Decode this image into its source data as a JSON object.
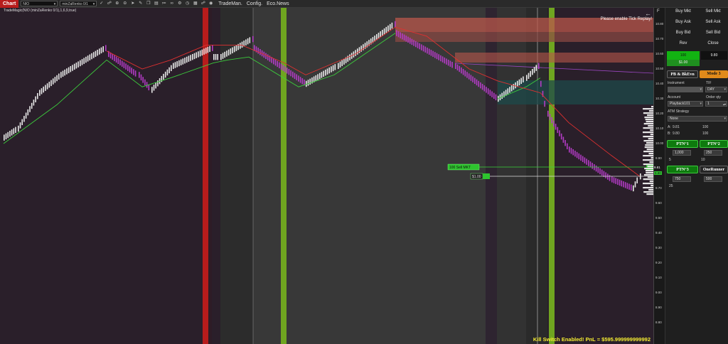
{
  "toolbar": {
    "tab": "Chart",
    "instrument": "NIO",
    "bars_type": "minZaRenko 0/1",
    "menus": [
      "TradeMan.",
      "Config.",
      "Eco.News"
    ],
    "icons": [
      "scale-icon",
      "link-icon",
      "zoom-in-icon",
      "zoom-out-icon",
      "pointer-icon",
      "drawing-icon",
      "copy-icon",
      "template-icon",
      "indicator-icon",
      "strategy-icon",
      "properties-icon",
      "time-icon",
      "grid-icon",
      "lock-icon",
      "camera-icon"
    ]
  },
  "chart": {
    "indicator_label": "TradeMagic(NIO (minZaRenko 0/1),1,6,9,true)",
    "tick_replay_msg": "Please enable Tick Replay!",
    "kill_switch_msg": "Kill Switch Enabled! PnL = $595.999999999992",
    "order_tags": {
      "upper_label": "100 Sell MKT",
      "upper_value": "9.80",
      "lower_label": "$1.00",
      "lower_value": "9.80"
    },
    "price_axis": {
      "header": "F",
      "ticks": [
        "10.80",
        "10.70",
        "10.60",
        "10.50",
        "10.40",
        "10.30",
        "10.20",
        "10.10",
        "10.00",
        "9.90",
        "9.80",
        "9.70",
        "9.60",
        "9.50",
        "9.40",
        "9.30",
        "9.20",
        "9.10",
        "9.00",
        "8.90",
        "8.80"
      ],
      "current_price": "9.80",
      "marker_price": "9.81"
    },
    "colors": {
      "background": "#2a1f2a",
      "green_band": "#6fa520",
      "red_band": "#b71c1c",
      "up_bar": "#e8e8e8",
      "down_bar": "#b23bc4",
      "stop_red": "#e03030",
      "stop_green": "#3ccc3c"
    }
  },
  "chart_trader": {
    "buy_mkt": "Buy Mkt",
    "sell_mkt": "Sell Mkt",
    "buy_ask": "Buy Ask",
    "sell_ask": "Sell Ask",
    "buy_bid": "Buy Bid",
    "sell_bid": "Sell Bid",
    "rev": "Rev",
    "close": "Close",
    "position_qty": "100",
    "position_price": "9.80",
    "pnl": "$1.00",
    "pb_btn": "PB & BkEvn",
    "mode_btn": "Mode 3",
    "instrument_label": "Instrument",
    "tif_label": "TIF",
    "tif_value": "DAY",
    "account_label": "Account",
    "account_value": "Playback101",
    "order_qty_label": "Order qty",
    "order_qty_value": "1",
    "atm_label": "ATM Strategy",
    "atm_value": "None",
    "a_label": "A:",
    "a_price": "9.81",
    "a_qty": "100",
    "b_label": "B:",
    "b_price": "9.80",
    "b_qty": "100",
    "ptn1": "PTN°1",
    "ptn2": "PTN°2",
    "ptn1_value": "1,000",
    "ptn2_value": "250",
    "ptn1_extra": "5",
    "ptn2_extra": "10",
    "ptn3": "PTN°3",
    "one_runner": "OneRunner",
    "ptn3_value": "750",
    "one_runner_value": "500",
    "ptn3_extra": "25"
  }
}
